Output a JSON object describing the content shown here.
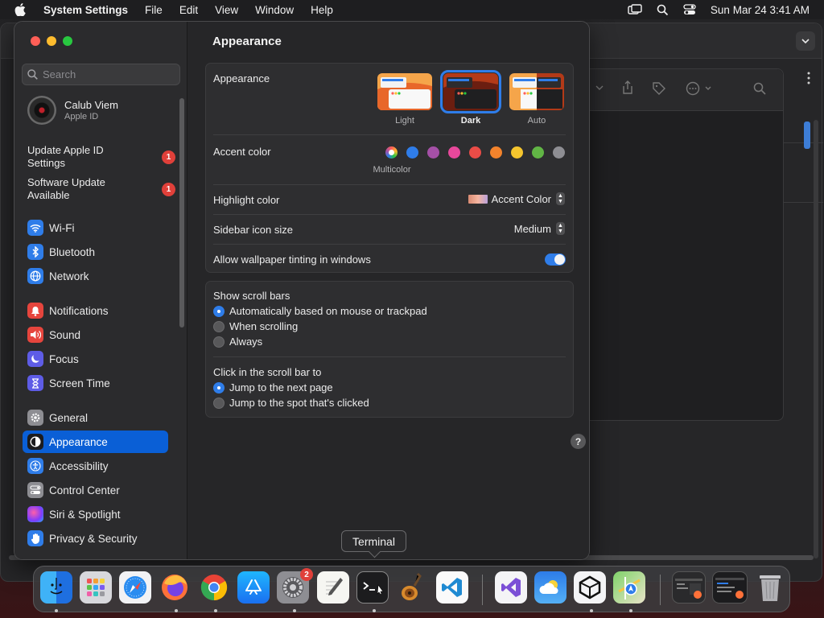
{
  "menubar": {
    "app_name": "System Settings",
    "menus": [
      "File",
      "Edit",
      "View",
      "Window",
      "Help"
    ],
    "clock": "Sun Mar 24  3:41 AM"
  },
  "sidebar": {
    "search_placeholder": "Search",
    "user": {
      "name": "Calub Viem",
      "subtitle": "Apple ID"
    },
    "alerts": [
      {
        "label": "Update Apple ID Settings",
        "count": "1"
      },
      {
        "label": "Software Update Available",
        "count": "1"
      }
    ],
    "items": [
      {
        "label": "Wi-Fi",
        "icon": "wifi-icon",
        "color": "#2f7de9"
      },
      {
        "label": "Bluetooth",
        "icon": "bluetooth-icon",
        "color": "#2f7de9"
      },
      {
        "label": "Network",
        "icon": "globe-icon",
        "color": "#2f7de9"
      },
      {
        "label": "Notifications",
        "icon": "bell-icon",
        "color": "#e6453d"
      },
      {
        "label": "Sound",
        "icon": "speaker-icon",
        "color": "#e6453d"
      },
      {
        "label": "Focus",
        "icon": "moon-icon",
        "color": "#5e5ce6"
      },
      {
        "label": "Screen Time",
        "icon": "hourglass-icon",
        "color": "#5e5ce6"
      },
      {
        "label": "General",
        "icon": "gear-icon",
        "color": "#8e8e93"
      },
      {
        "label": "Appearance",
        "icon": "appearance-icon",
        "color": "#1c1c1e"
      },
      {
        "label": "Accessibility",
        "icon": "accessibility-icon",
        "color": "#2f7de9"
      },
      {
        "label": "Control Center",
        "icon": "control-center-icon",
        "color": "#8e8e93"
      },
      {
        "label": "Siri & Spotlight",
        "icon": "siri-icon",
        "color": "#b04ad8"
      },
      {
        "label": "Privacy & Security",
        "icon": "hand-icon",
        "color": "#2f7de9"
      }
    ],
    "active": "Appearance"
  },
  "main": {
    "title": "Appearance",
    "appearance": {
      "label": "Appearance",
      "options": [
        "Light",
        "Dark",
        "Auto"
      ],
      "selected": "Dark"
    },
    "accent": {
      "label": "Accent color",
      "caption": "Multicolor",
      "colors": [
        "multicolor",
        "#2f7de9",
        "#a550a7",
        "#e8489b",
        "#ea4c47",
        "#f3832c",
        "#f5c52e",
        "#61b545",
        "#8e8e93"
      ]
    },
    "highlight": {
      "label": "Highlight color",
      "value": "Accent Color"
    },
    "sidebar_icon_size": {
      "label": "Sidebar icon size",
      "value": "Medium"
    },
    "wallpaper_tinting": {
      "label": "Allow wallpaper tinting in windows",
      "on": true
    },
    "scroll_bars": {
      "label": "Show scroll bars",
      "options": [
        "Automatically based on mouse or trackpad",
        "When scrolling",
        "Always"
      ],
      "selected": 0
    },
    "click_scroll": {
      "label": "Click in the scroll bar to",
      "options": [
        "Jump to the next page",
        "Jump to the spot that's clicked"
      ],
      "selected": 0
    },
    "help": "?"
  },
  "dock": {
    "tooltip": "Terminal",
    "settings_badge": "2",
    "apps": [
      "Finder",
      "Launchpad",
      "Safari",
      "Firefox",
      "Chrome",
      "App Store",
      "System Settings",
      "TextEdit",
      "Terminal",
      "GarageBand",
      "Visual Studio Code",
      "Visual Studio",
      "Weather",
      "Unity",
      "Maps",
      "Window 1",
      "Window 2",
      "Trash"
    ]
  }
}
